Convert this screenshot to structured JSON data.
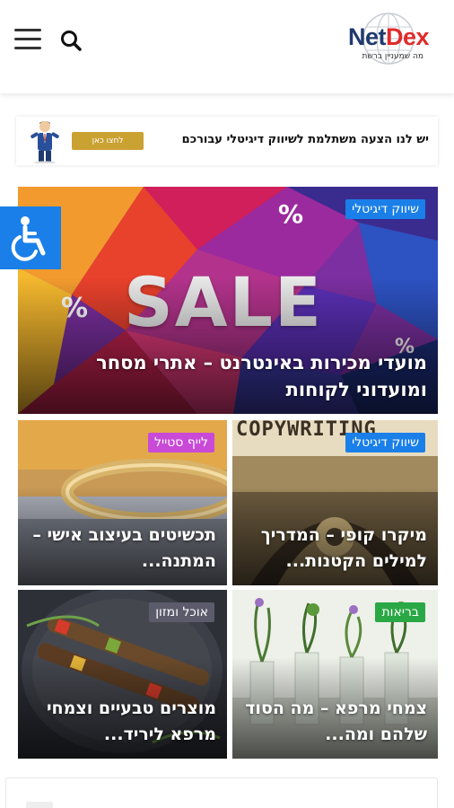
{
  "header": {
    "logo": {
      "word_net": "Net",
      "word_dex": "Dex",
      "tagline": "מה שמעניין ברשת"
    },
    "menu_icon": "hamburger-menu-icon",
    "search_icon": "search-icon"
  },
  "promo_banner": {
    "text": "יש לנו הצעה משתלמת לשיווק דיגיטלי עבורכם",
    "button_label": "לחצו כאן",
    "button_color": "#caa232"
  },
  "accessibility": {
    "icon": "wheelchair-icon",
    "color": "#1a7fe8"
  },
  "hero": {
    "image_text": "SALE",
    "category": "שיווק דיגיטלי",
    "category_color": "#1a7fe8",
    "title": "מועדי מכירות באינטרנט – אתרי מסחר ומועדוני לקוחות"
  },
  "articles": [
    {
      "category": "שיווק דיגיטלי",
      "category_color": "#1a7fe8",
      "title": "מיקרו קופי – המדריך למילים הקטנות...",
      "image_text": "COPYWRITING"
    },
    {
      "category": "לייף סטייל",
      "category_color": "#c94ad6",
      "title": "תכשיטים בעיצוב אישי – המתנה..."
    },
    {
      "category": "בריאות",
      "category_color": "#2aa845",
      "title": "צמחי מרפא – מה הסוד שלהם ומה..."
    },
    {
      "category": "אוכל ומזון",
      "category_color": "#5b5b6b",
      "title": "מוצרים טבעיים וצמחי מרפא ליריד..."
    }
  ]
}
